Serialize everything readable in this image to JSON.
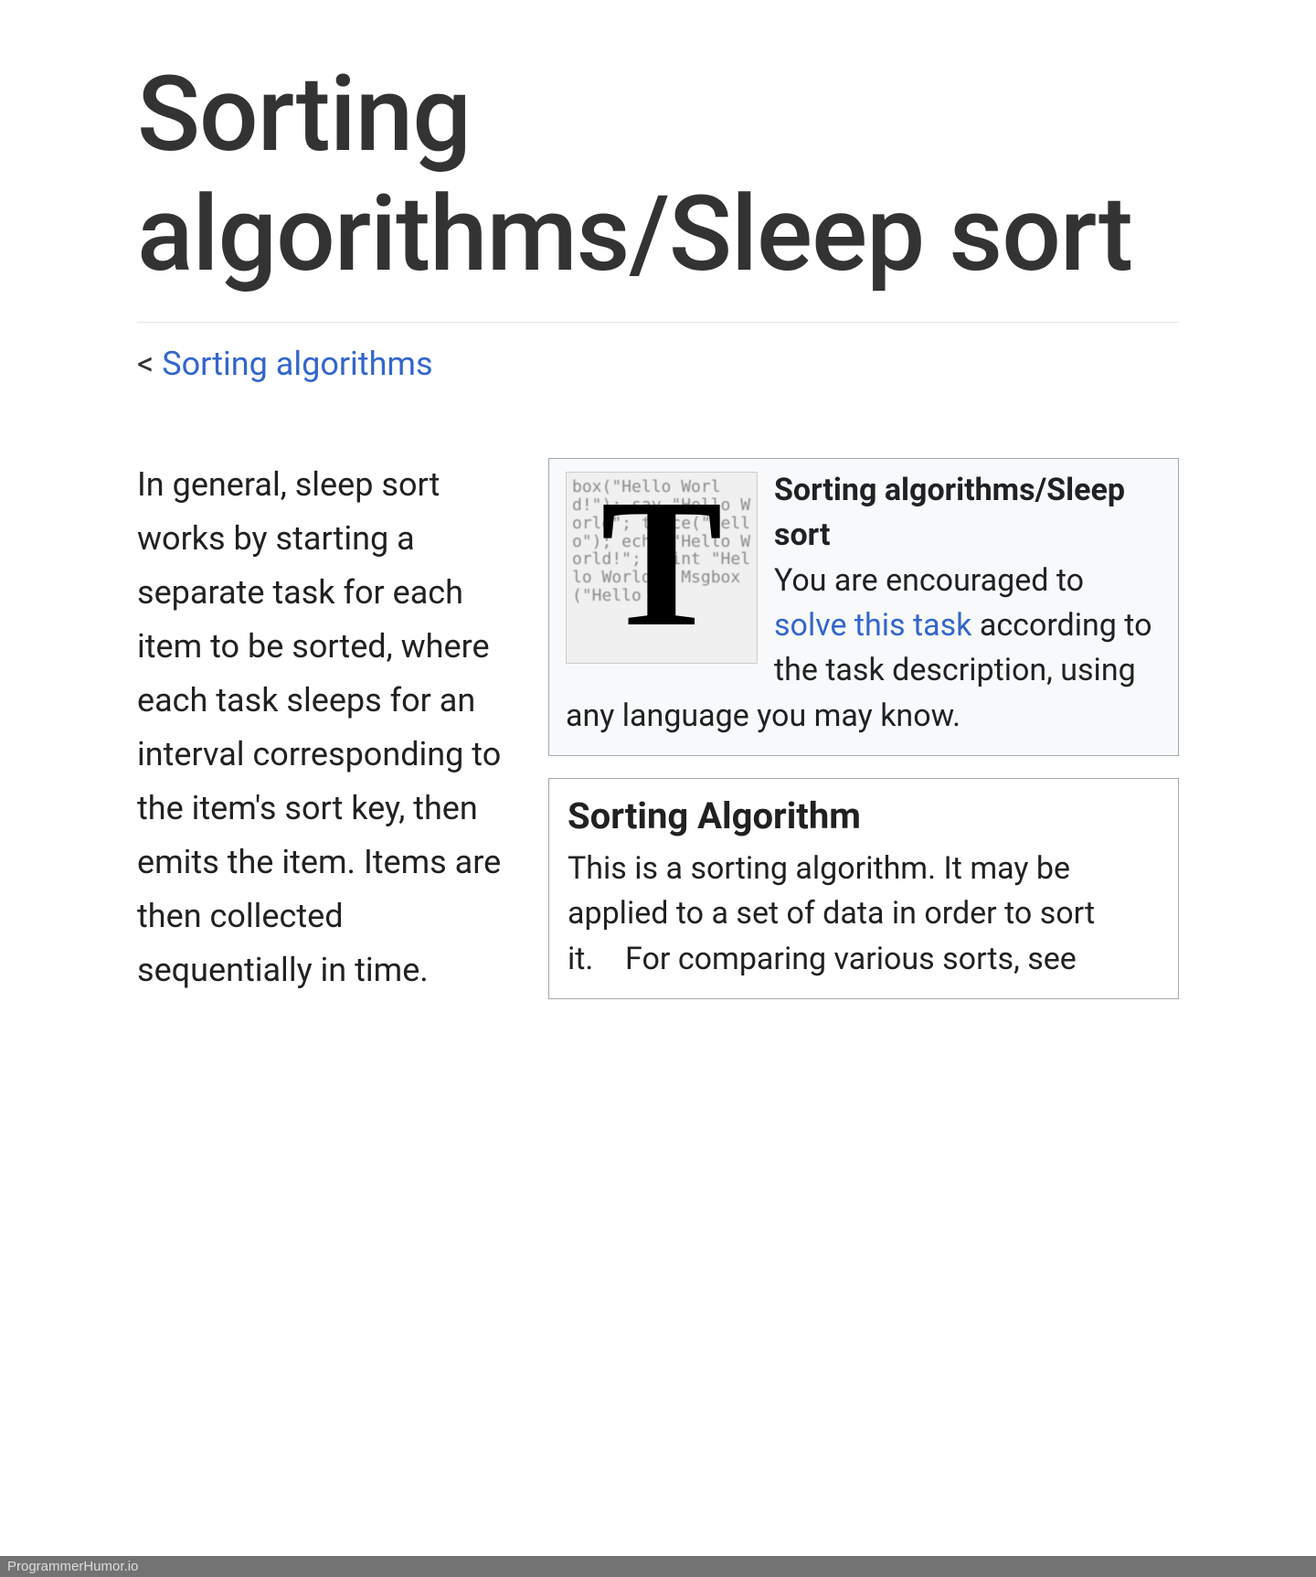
{
  "page": {
    "title": "Sorting algorithms/Sleep sort"
  },
  "breadcrumb": {
    "prefix": "< ",
    "link_text": "Sorting algorithms"
  },
  "main": {
    "paragraph": "In general, sleep sort works by starting a separate task for each item to be sorted, where each task sleeps for an interval corresponding to the item's sort key, then emits the item. Items are then collected sequentially in time."
  },
  "infobox": {
    "icon_name": "task-t-icon",
    "icon_bg_text": "box(\"Hello World!\"); say \"Hello World\"; trace(\"Hello\"); echo \"Hello World!\"; print \"Hello World\"; Msgbox(\"Hello",
    "title": "Sorting algorithms/Sleep sort",
    "text_before_link": "You are encouraged to ",
    "link_text": "solve this task",
    "text_after_link": " according to the task description, using any language you may know."
  },
  "algobox": {
    "title": "Sorting Algorithm",
    "body": "This is a sorting algorithm. It may be applied to a set of data in order to sort it. For comparing various sorts, see"
  },
  "watermark": "ProgrammerHumor.io"
}
